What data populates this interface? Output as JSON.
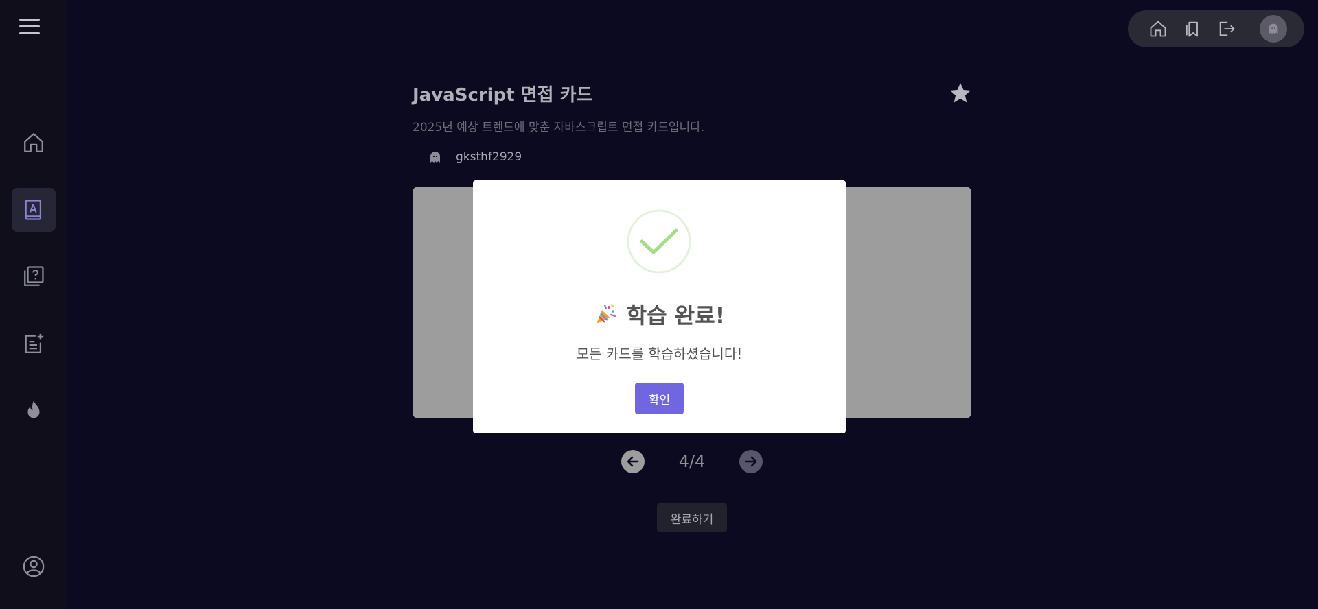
{
  "sidebar": {
    "menu_icon": "hamburger-icon",
    "items": [
      {
        "name": "home",
        "icon": "home-icon"
      },
      {
        "name": "study",
        "icon": "book-icon",
        "active": true
      },
      {
        "name": "quiz",
        "icon": "question-stack-icon"
      },
      {
        "name": "add-note",
        "icon": "note-add-icon"
      },
      {
        "name": "popular",
        "icon": "fire-icon"
      }
    ],
    "profile_icon": "user-circle-icon"
  },
  "topbar": {
    "icons": [
      "home-icon",
      "bookmark-icon",
      "logout-icon",
      "avatar"
    ]
  },
  "deck": {
    "title": "JavaScript 면접 카드",
    "description": "2025년 예상 트렌드에 맞춘 자바스크립트 면접 카드입니다.",
    "author": "gksthf2929"
  },
  "pagination": {
    "current": "4/4"
  },
  "finish_label": "완료하기",
  "modal": {
    "title": "학습 완료!",
    "emoji": "🎉",
    "message": "모든 카드를 학습하셨습니다!",
    "confirm_label": "확인"
  },
  "colors": {
    "background": "#0b0a21",
    "sidebar": "#0f0e1a",
    "accent": "#7066e0",
    "success": "#a5dc86"
  }
}
